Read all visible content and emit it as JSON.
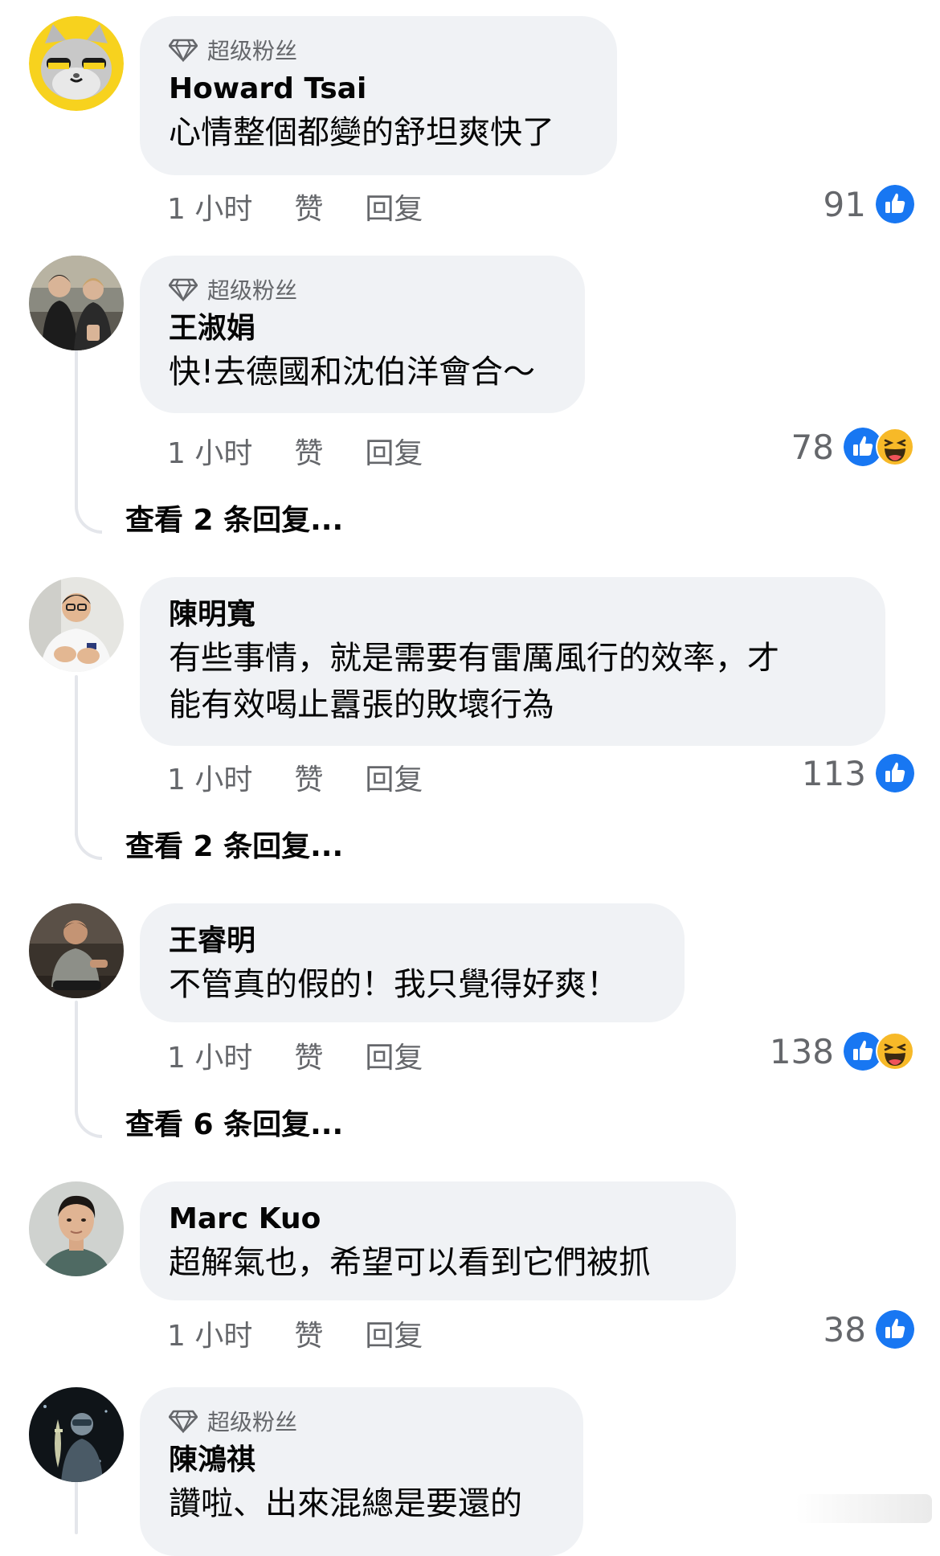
{
  "comments": [
    {
      "badge": "超级粉丝",
      "name": "Howard Tsai",
      "text_lines": [
        "心情整個都變的舒坦爽快了"
      ],
      "time": "1 小时",
      "like": "赞",
      "reply": "回复",
      "count": "91",
      "reactions": [
        "like"
      ],
      "avatar_icon": "cartoon-cat-avatar"
    },
    {
      "badge": "超级粉丝",
      "name": "王淑娟",
      "text_lines": [
        "快!去德國和沈伯洋會合～"
      ],
      "time": "1 小时",
      "like": "赞",
      "reply": "回复",
      "count": "78",
      "reactions": [
        "like",
        "haha"
      ],
      "view_replies": "查看 2 条回复...",
      "avatar_icon": "couple-photo-avatar"
    },
    {
      "name": "陳明寬",
      "text_lines": [
        "有些事情，就是需要有雷厲風行的效率，才",
        "能有效喝止囂張的敗壞行為"
      ],
      "time": "1 小时",
      "like": "赞",
      "reply": "回复",
      "count": "113",
      "reactions": [
        "like"
      ],
      "view_replies": "查看 2 条回复...",
      "avatar_icon": "man-white-shirt-avatar"
    },
    {
      "name": "王睿明",
      "text_lines": [
        "不管真的假的！我只覺得好爽！"
      ],
      "time": "1 小时",
      "like": "赞",
      "reply": "回复",
      "count": "138",
      "reactions": [
        "like",
        "haha"
      ],
      "view_replies": "查看 6 条回复...",
      "avatar_icon": "man-seated-avatar"
    },
    {
      "name": "Marc Kuo",
      "text_lines": [
        "超解氣也，希望可以看到它們被抓"
      ],
      "time": "1 小时",
      "like": "赞",
      "reply": "回复",
      "count": "38",
      "reactions": [
        "like"
      ],
      "avatar_icon": "young-man-portrait-avatar"
    },
    {
      "badge": "超级粉丝",
      "name": "陳鴻祺",
      "text_lines": [
        "讚啦、出來混總是要還的"
      ],
      "avatar_icon": "fisherman-night-avatar"
    }
  ],
  "colors": {
    "bubble": "#f0f2f5",
    "meta_text": "#65676b",
    "like_blue": "#1877f2",
    "haha_yellow": "#f7b928",
    "thread_line": "#e4e6eb"
  },
  "icons": {
    "badge": "diamond-icon",
    "like": "like-thumbs-up-icon",
    "haha": "haha-emoji-icon"
  }
}
